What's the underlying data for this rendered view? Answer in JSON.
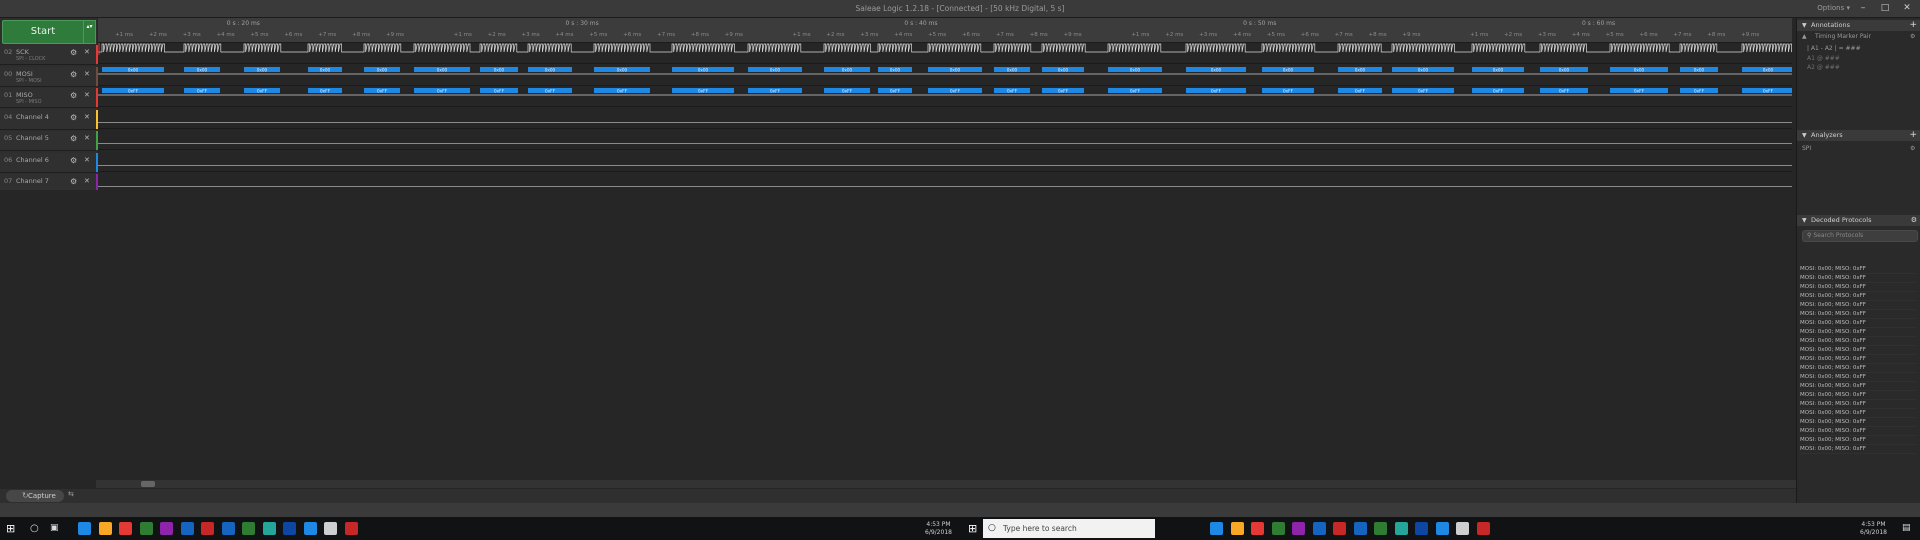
{
  "window": {
    "title": "Saleae Logic 1.2.18 - [Connected] - [50 kHz Digital, 5 s]",
    "options_label": "Options ▾",
    "controls": [
      "–",
      "□",
      "✕"
    ]
  },
  "start_button": {
    "label": "Start",
    "arrow": "▴▾"
  },
  "channel_header_icons": [
    "⚙",
    "↑",
    "S",
    "✕"
  ],
  "channels": [
    {
      "num": "02",
      "name": "SCK",
      "sub": "SPI - CLOCK",
      "color": "#e53935"
    },
    {
      "num": "00",
      "name": "MOSI",
      "sub": "SPI - MOSI",
      "color": "#6d4c41"
    },
    {
      "num": "01",
      "name": "MISO",
      "sub": "SPI - MISO",
      "color": "#e53935"
    },
    {
      "num": "04",
      "name": "Channel 4",
      "sub": "",
      "color": "#fbc02d"
    },
    {
      "num": "05",
      "name": "Channel 5",
      "sub": "",
      "color": "#43a047"
    },
    {
      "num": "06",
      "name": "Channel 6",
      "sub": "",
      "color": "#1e88e5"
    },
    {
      "num": "07",
      "name": "Channel 7",
      "sub": "",
      "color": "#8e24aa"
    }
  ],
  "timeline": {
    "major": [
      "0 s : 20 ms",
      "0 s : 30 ms",
      "0 s : 40 ms",
      "0 s : 50 ms",
      "0 s : 60 ms"
    ],
    "minor": [
      "+1 ms",
      "+2 ms",
      "+3 ms",
      "+4 ms",
      "+5 ms",
      "+6 ms",
      "+7 ms",
      "+8 ms",
      "+9 ms"
    ]
  },
  "decode": {
    "mosi_value": "0x00",
    "miso_value": "0xFF"
  },
  "capture_tab": {
    "label": "Capture",
    "icon": "refresh-icon"
  },
  "panels": {
    "annotations": {
      "title": "Annotations",
      "item": "Timing Marker Pair",
      "row": "| A1 - A2 | = ###",
      "a1": "A1  @  ###",
      "a2": "A2  @  ###"
    },
    "analyzers": {
      "title": "Analyzers",
      "item": "SPI"
    },
    "decoded": {
      "title": "Decoded Protocols",
      "search_placeholder": "Search Protocols"
    }
  },
  "decoded_rows": [
    "MOSI: 0x00;  MISO: 0xFF",
    "MOSI: 0x00;  MISO: 0xFF",
    "MOSI: 0x00;  MISO: 0xFF",
    "MOSI: 0x00;  MISO: 0xFF",
    "MOSI: 0x00;  MISO: 0xFF",
    "MOSI: 0x00;  MISO: 0xFF",
    "MOSI: 0x00;  MISO: 0xFF",
    "MOSI: 0x00;  MISO: 0xFF",
    "MOSI: 0x00;  MISO: 0xFF",
    "MOSI: 0x00;  MISO: 0xFF",
    "MOSI: 0x00;  MISO: 0xFF",
    "MOSI: 0x00;  MISO: 0xFF",
    "MOSI: 0x00;  MISO: 0xFF",
    "MOSI: 0x00;  MISO: 0xFF",
    "MOSI: 0x00;  MISO: 0xFF",
    "MOSI: 0x00;  MISO: 0xFF",
    "MOSI: 0x00;  MISO: 0xFF",
    "MOSI: 0x00;  MISO: 0xFF",
    "MOSI: 0x00;  MISO: 0xFF",
    "MOSI: 0x00;  MISO: 0xFF",
    "MOSI: 0x00;  MISO: 0xFF"
  ],
  "taskbar": {
    "search_placeholder": "Type here to search",
    "clock_left": {
      "time": "4:53 PM",
      "date": "6/9/2018"
    },
    "clock_right": {
      "time": "4:53 PM",
      "date": "6/9/2018"
    },
    "apps": [
      "#1e88e5",
      "#f9a825",
      "#e53935",
      "#2e7d32",
      "#8e24aa",
      "#1565c0",
      "#c62828",
      "#1565c0",
      "#2e7d32",
      "#26a69a",
      "#0d47a1",
      "#1e88e5",
      "#cfcfcf",
      "#c62828"
    ]
  }
}
